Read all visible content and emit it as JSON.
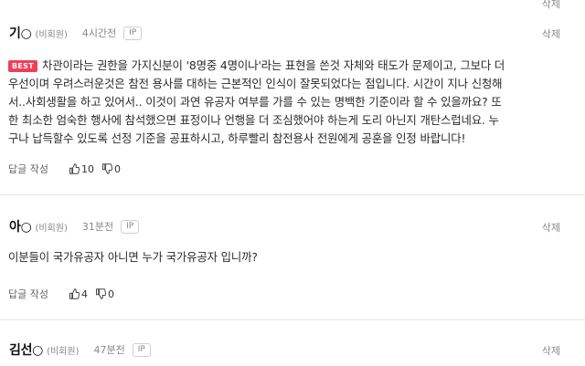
{
  "comments": [
    {
      "nick": "기○",
      "member_type": "(비회원)",
      "time": "4시간전",
      "ip": "IP",
      "delete_label": "삭제",
      "best": "BEST",
      "lines": [
        "차관이라는 권한을 가지신분이 '8명중 4명이나'라는 표현을 쓴것 자체와 태도가 문제이고, 그보다 더",
        "우선이며 우려스러운것은 참전 용사를 대하는 근본적인 인식이 잘못되었다는 점입니다. 시간이 지나 신청해",
        "서..사회생활을 하고 있어서.. 이것이 과연 유공자 여부를 가를 수 있는 명백한 기준이라 할 수 있을까요? 또",
        "한 최소한 엄숙한 행사에 참석했으면 표정이나 언행을 더 조심했어야 하는게 도리 아닌지 개탄스럽네요. 누",
        "구나 납득할수 있도록 선정 기준을 공표하시고, 하루빨리 참전용사 전원에게 공훈을 인정 바랍니다!"
      ],
      "reply_label": "답글 작성",
      "likes": "10",
      "dislikes": "0"
    },
    {
      "nick": "아○",
      "member_type": "(비회원)",
      "time": "31분전",
      "ip": "IP",
      "delete_label": "삭제",
      "lines": [
        "이분들이 국가유공자 아니면 누가 국가유공자 입니까?"
      ],
      "reply_label": "답글 작성",
      "likes": "4",
      "dislikes": "0"
    },
    {
      "nick": "김선○",
      "member_type": "(비회원)",
      "time": "47분전",
      "ip": "IP",
      "delete_label": "삭제"
    }
  ],
  "top_right_label": "삭제"
}
